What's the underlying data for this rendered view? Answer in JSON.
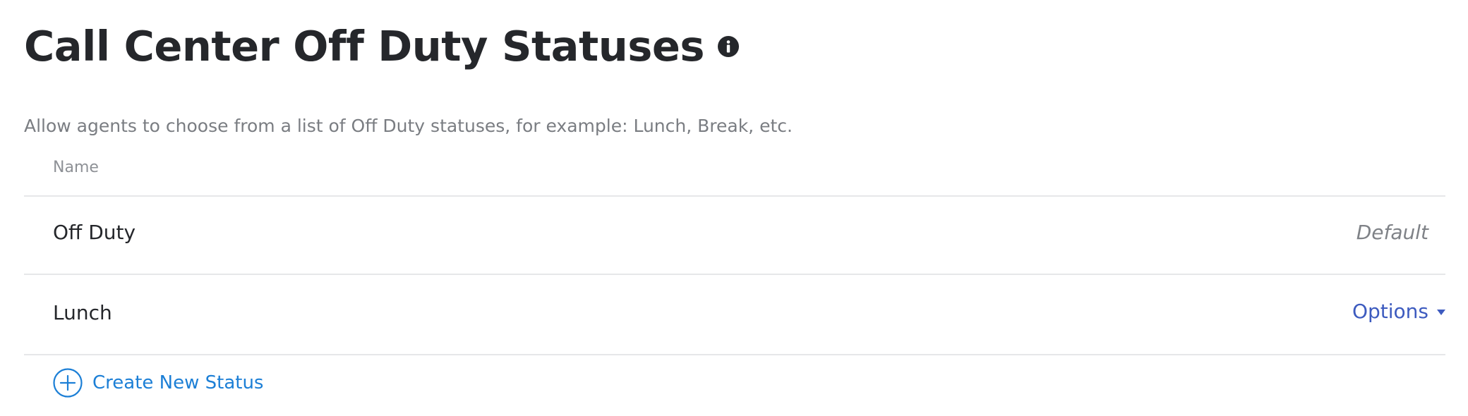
{
  "header": {
    "title": "Call Center Off Duty Statuses",
    "info_icon": "info-icon"
  },
  "description": "Allow agents to choose from a list of Off Duty statuses, for example: Lunch, Break, etc.",
  "table": {
    "columns": [
      "Name"
    ],
    "rows": [
      {
        "name": "Off Duty",
        "meta": "Default"
      },
      {
        "name": "Lunch",
        "action": "Options"
      }
    ]
  },
  "create": {
    "label": "Create New Status",
    "icon": "plus-circle-icon"
  },
  "colors": {
    "title": "#25272b",
    "description": "#7a7d82",
    "options_link": "#3d5bbf",
    "create_link": "#1c7fd6",
    "divider": "#e6e7e9"
  }
}
